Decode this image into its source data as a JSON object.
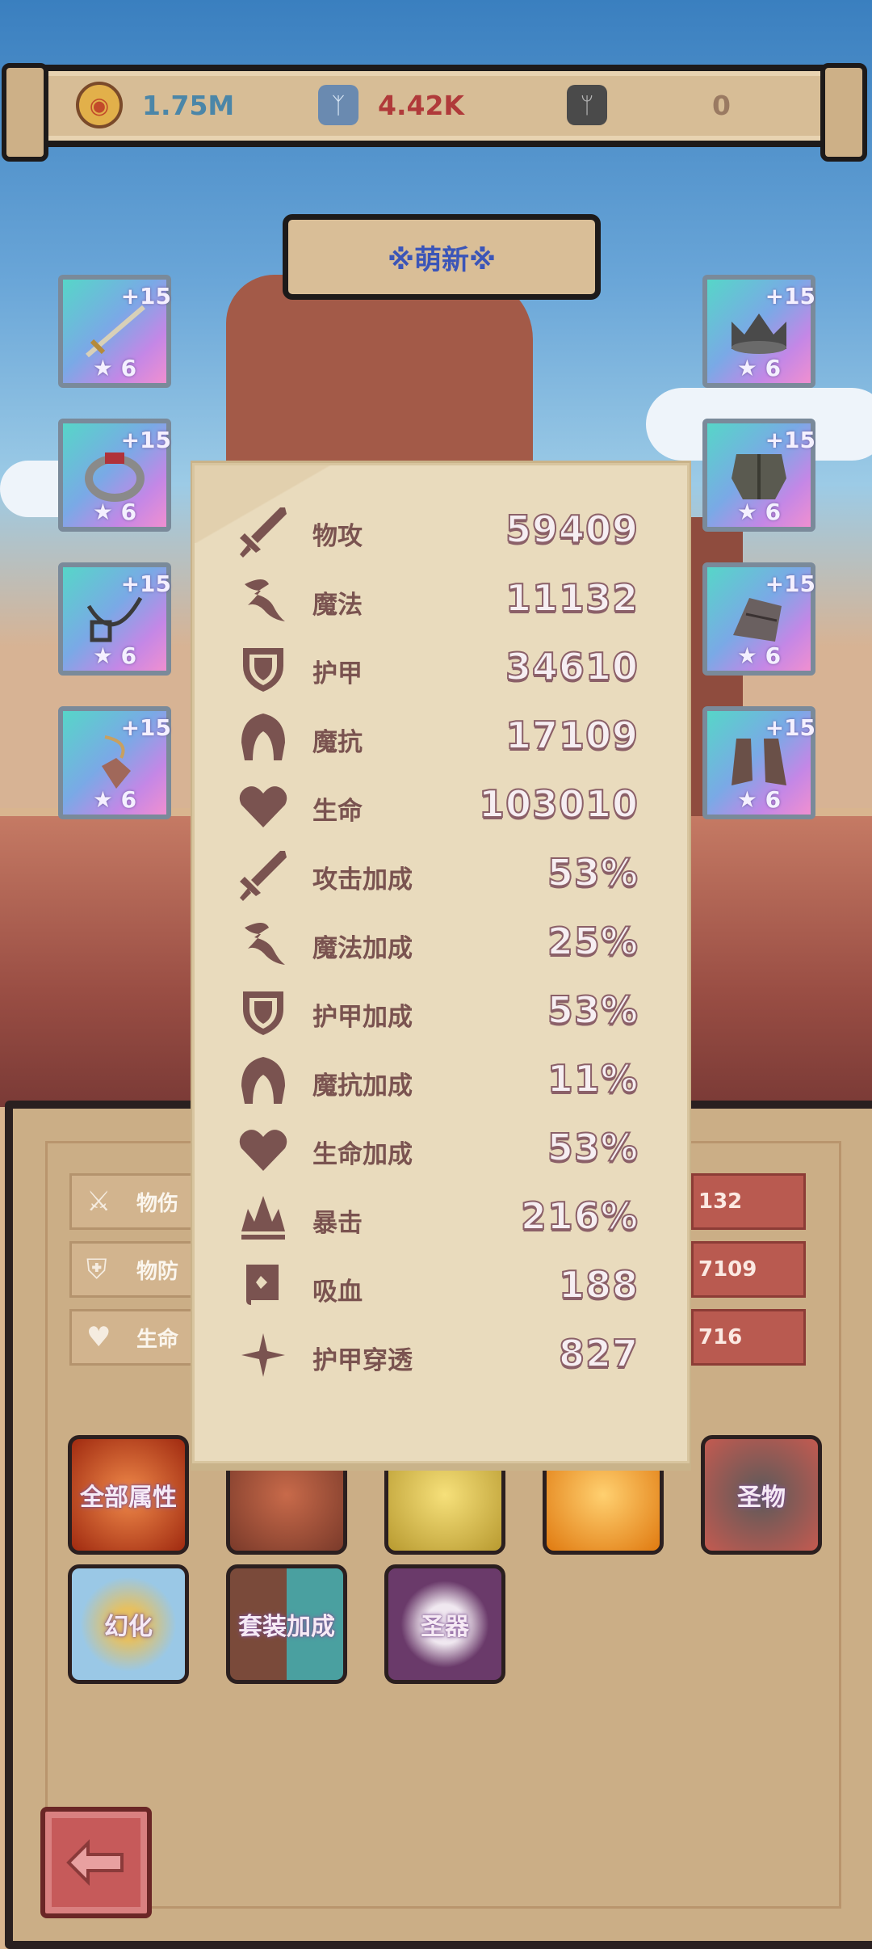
{
  "resources": [
    {
      "name": "gold-coin",
      "icon": "coin-icon",
      "value": "1.75M",
      "color": "#4b86a8"
    },
    {
      "name": "blue-rune",
      "icon": "rune-icon",
      "value": "4.42K",
      "color": "#b03a3a"
    },
    {
      "name": "gray-rune",
      "icon": "gray-rune-icon",
      "value": "0",
      "color": "#9a7a62"
    }
  ],
  "title": "※萌新※",
  "equipment": {
    "left": [
      {
        "name": "sword",
        "level": "+15",
        "stars": "★ 6"
      },
      {
        "name": "ring",
        "level": "+15",
        "stars": "★ 6"
      },
      {
        "name": "necklace",
        "level": "+15",
        "stars": "★ 6"
      },
      {
        "name": "amulet",
        "level": "+15",
        "stars": "★ 6"
      }
    ],
    "right": [
      {
        "name": "crown",
        "level": "+15",
        "stars": "★ 6"
      },
      {
        "name": "armor",
        "level": "+15",
        "stars": "★ 6"
      },
      {
        "name": "gauntlet",
        "level": "+15",
        "stars": "★ 6"
      },
      {
        "name": "boots",
        "level": "+15",
        "stars": "★ 6"
      }
    ]
  },
  "panel_stats": [
    {
      "label": "物伤",
      "icon": "sword-icon",
      "value": "132"
    },
    {
      "label": "物防",
      "icon": "shield-icon",
      "value": "7109"
    },
    {
      "label": "生命",
      "icon": "heart-icon",
      "value": "716"
    }
  ],
  "tiles_row1": [
    {
      "label": "全部属性",
      "color": "#c2502a"
    },
    {
      "label": "",
      "color": "#a35040"
    },
    {
      "label": "",
      "color": "#d9c050"
    },
    {
      "label": "",
      "color": "#f0a020"
    },
    {
      "label": "圣物",
      "color": "#7a5a5a"
    }
  ],
  "tiles_row2": [
    {
      "label": "幻化",
      "color": "#9ac8e6"
    },
    {
      "label": "套装加成",
      "color": "#7a4a3a"
    },
    {
      "label": "圣器",
      "color": "#6a3a6a"
    }
  ],
  "popup_stats": [
    {
      "label": "物攻",
      "icon": "sword-icon",
      "value": "59409"
    },
    {
      "label": "魔法",
      "icon": "magic-icon",
      "value": "11132"
    },
    {
      "label": "护甲",
      "icon": "shield-icon",
      "value": "34610"
    },
    {
      "label": "魔抗",
      "icon": "hood-icon",
      "value": "17109"
    },
    {
      "label": "生命",
      "icon": "heart-icon",
      "value": "103010"
    },
    {
      "label": "攻击加成",
      "icon": "sword-icon",
      "value": "53%"
    },
    {
      "label": "魔法加成",
      "icon": "magic-icon",
      "value": "25%"
    },
    {
      "label": "护甲加成",
      "icon": "shield-icon",
      "value": "53%"
    },
    {
      "label": "魔抗加成",
      "icon": "hood-icon",
      "value": "11%"
    },
    {
      "label": "生命加成",
      "icon": "heart-icon",
      "value": "53%"
    },
    {
      "label": "暴击",
      "icon": "crit-icon",
      "value": "216%"
    },
    {
      "label": "吸血",
      "icon": "book-icon",
      "value": "188"
    },
    {
      "label": "护甲穿透",
      "icon": "star-icon",
      "value": "827"
    }
  ]
}
